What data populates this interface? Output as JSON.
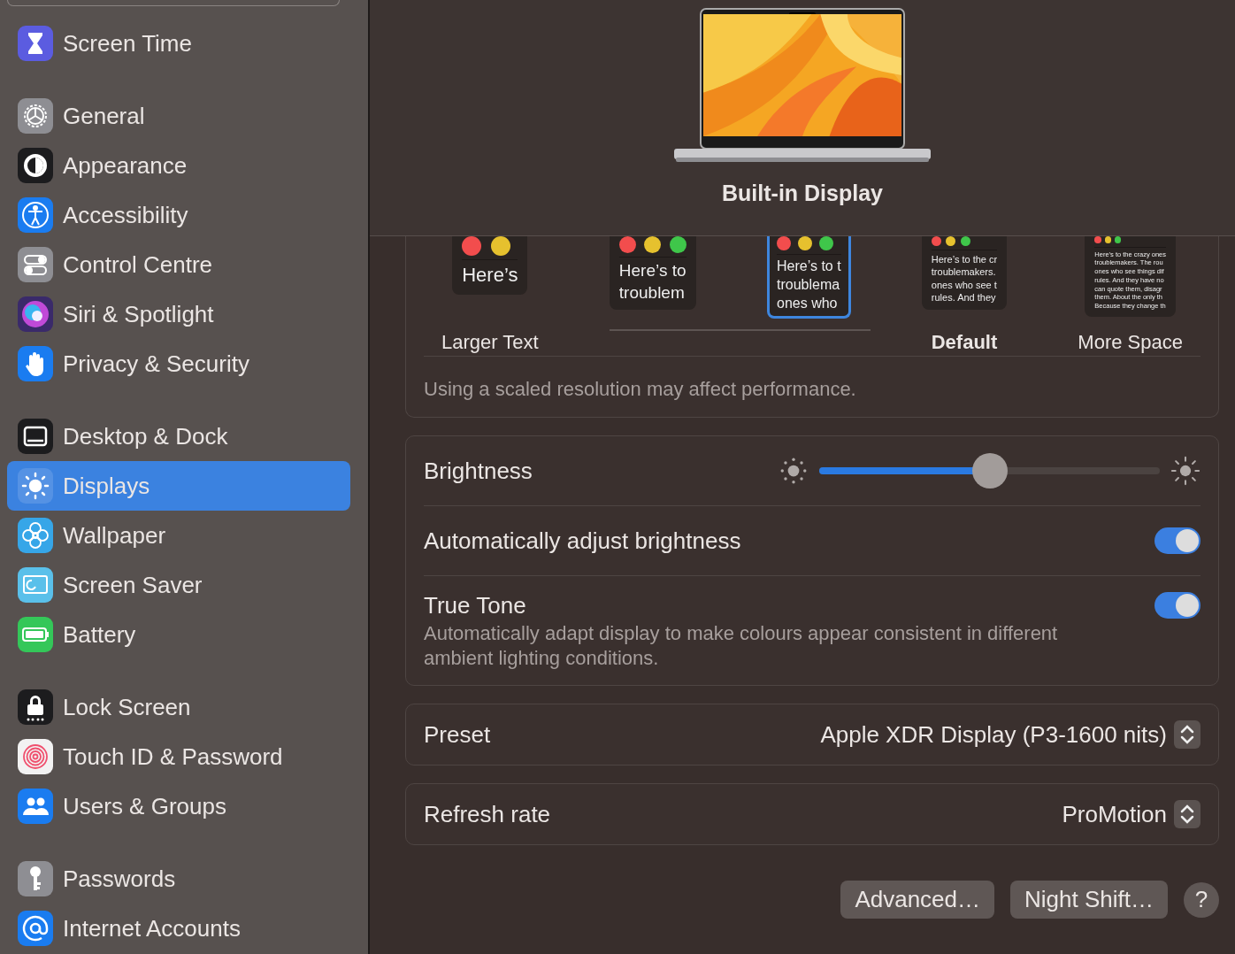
{
  "sidebar": {
    "groups": [
      {
        "items": [
          {
            "label": "Screen Time",
            "kind": "hourglass",
            "selected": false
          }
        ]
      },
      {
        "items": [
          {
            "label": "General",
            "kind": "gear",
            "selected": false
          },
          {
            "label": "Appearance",
            "kind": "appearance",
            "selected": false
          },
          {
            "label": "Accessibility",
            "kind": "accessibility",
            "selected": false
          },
          {
            "label": "Control Centre",
            "kind": "toggles",
            "selected": false
          },
          {
            "label": "Siri & Spotlight",
            "kind": "siri",
            "selected": false
          },
          {
            "label": "Privacy & Security",
            "kind": "hand",
            "selected": false
          }
        ]
      },
      {
        "items": [
          {
            "label": "Desktop & Dock",
            "kind": "dock",
            "selected": false
          },
          {
            "label": "Displays",
            "kind": "sun",
            "selected": true
          },
          {
            "label": "Wallpaper",
            "kind": "flower",
            "selected": false
          },
          {
            "label": "Screen Saver",
            "kind": "screensaver",
            "selected": false
          },
          {
            "label": "Battery",
            "kind": "battery",
            "selected": false
          }
        ]
      },
      {
        "items": [
          {
            "label": "Lock Screen",
            "kind": "lock",
            "selected": false
          },
          {
            "label": "Touch ID & Password",
            "kind": "fingerprint",
            "selected": false
          },
          {
            "label": "Users & Groups",
            "kind": "users",
            "selected": false
          }
        ]
      },
      {
        "items": [
          {
            "label": "Passwords",
            "kind": "key",
            "selected": false
          },
          {
            "label": "Internet Accounts",
            "kind": "at",
            "selected": false
          }
        ]
      }
    ]
  },
  "display": {
    "name": "Built-in Display"
  },
  "resolution": {
    "options": [
      {
        "label": "Larger Text",
        "default": false,
        "selected": false,
        "sample": [
          "Here’s"
        ]
      },
      {
        "selected": false,
        "sample": [
          "Here’s to",
          "troublem"
        ]
      },
      {
        "selected": true,
        "sample": [
          "Here’s to t",
          "troublema",
          "ones who"
        ]
      },
      {
        "label": "Default",
        "default": true,
        "selected": false,
        "sample": [
          "Here’s to the cr",
          "troublemakers.",
          "ones who see t",
          "rules. And they"
        ]
      },
      {
        "label": "More Space",
        "default": false,
        "selected": false,
        "sample": [
          "Here’s to the crazy ones",
          "troublemakers. The rou",
          "ones who see things dif",
          "rules. And they have no",
          "can quote them, disagr",
          "them. About the only th",
          "Because they change th"
        ]
      }
    ],
    "note": "Using a scaled resolution may affect performance."
  },
  "brightness": {
    "label": "Brightness",
    "level": 0.5
  },
  "auto_brightness": {
    "label": "Automatically adjust brightness",
    "on": true
  },
  "true_tone": {
    "label": "True Tone",
    "description": "Automatically adapt display to make colours appear consistent in different ambient lighting conditions.",
    "on": true
  },
  "preset": {
    "label": "Preset",
    "value": "Apple XDR Display (P3-1600 nits)"
  },
  "refresh_rate": {
    "label": "Refresh rate",
    "value": "ProMotion"
  },
  "buttons": [
    {
      "label": "Advanced…",
      "kind": "text"
    },
    {
      "label": "Night Shift…",
      "kind": "text"
    },
    {
      "label": "?",
      "kind": "help"
    }
  ]
}
